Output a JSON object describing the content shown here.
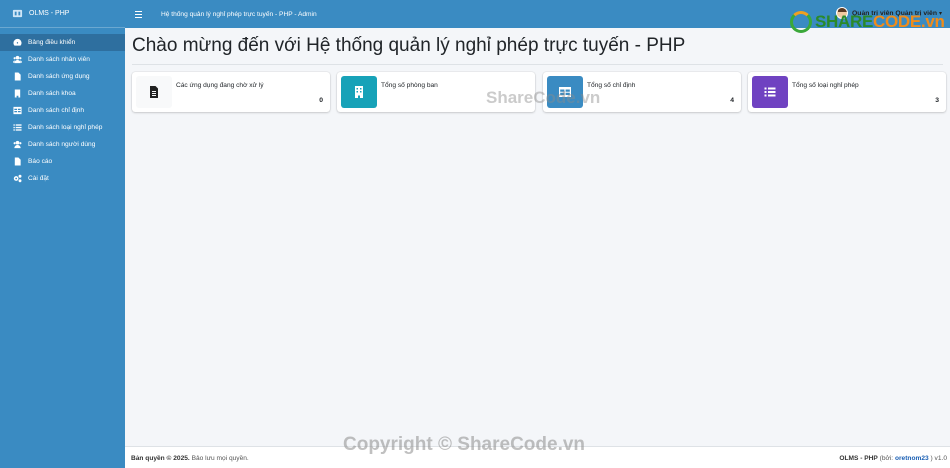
{
  "brand": {
    "name": "OLMS - PHP"
  },
  "navbar": {
    "title": "Hệ thống quản lý nghỉ phép trực tuyến - PHP - Admin",
    "user_label": "Quản trị viên Quản trị viên"
  },
  "sidebar": {
    "items": [
      {
        "label": "Bảng điều khiển",
        "icon": "dashboard-icon"
      },
      {
        "label": "Danh sách nhân viên",
        "icon": "users-icon"
      },
      {
        "label": "Danh sách ứng dụng",
        "icon": "file-icon"
      },
      {
        "label": "Danh sách khoa",
        "icon": "building-icon"
      },
      {
        "label": "Danh sách chỉ định",
        "icon": "table-icon"
      },
      {
        "label": "Danh sách loại nghỉ phép",
        "icon": "list-icon"
      },
      {
        "label": "Danh sách người dùng",
        "icon": "users-icon"
      },
      {
        "label": "Báo cáo",
        "icon": "file-icon"
      },
      {
        "label": "Cài đặt",
        "icon": "cogs-icon"
      }
    ]
  },
  "main": {
    "title": "Chào mừng đến với Hệ thống quản lý nghỉ phép trực tuyến - PHP",
    "cards": [
      {
        "label": "Các ứng dụng đang chờ xử lý",
        "value": "0",
        "icon": "file-icon",
        "color": "#f8f9fa"
      },
      {
        "label": "Tổng số phòng ban",
        "value": "",
        "icon": "building-icon",
        "color": "#17a2b8"
      },
      {
        "label": "Tổng số chỉ định",
        "value": "4",
        "icon": "table-icon",
        "color": "#3a8bc2"
      },
      {
        "label": "Tổng số loại nghỉ phép",
        "value": "3",
        "icon": "list-icon",
        "color": "#6f42c1"
      }
    ]
  },
  "footer": {
    "copyright_bold": "Bản quyền © 2025.",
    "copyright_rest": " Bảo lưu mọi quyền.",
    "app_bold": "OLMS - PHP",
    "by_open": " (bởi: ",
    "author": "oretnom23",
    "by_close": " ) v1.0"
  },
  "watermarks": {
    "logo_left": "SHARE",
    "logo_right": "CODE.vn",
    "middle": "ShareCode.vn",
    "bottom": "Copyright © ShareCode.vn"
  },
  "colors": {
    "primary": "#3a8bc2",
    "active": "#2e6f9f",
    "teal": "#17a2b8",
    "purple": "#6f42c1",
    "background": "#f4f6f9"
  }
}
